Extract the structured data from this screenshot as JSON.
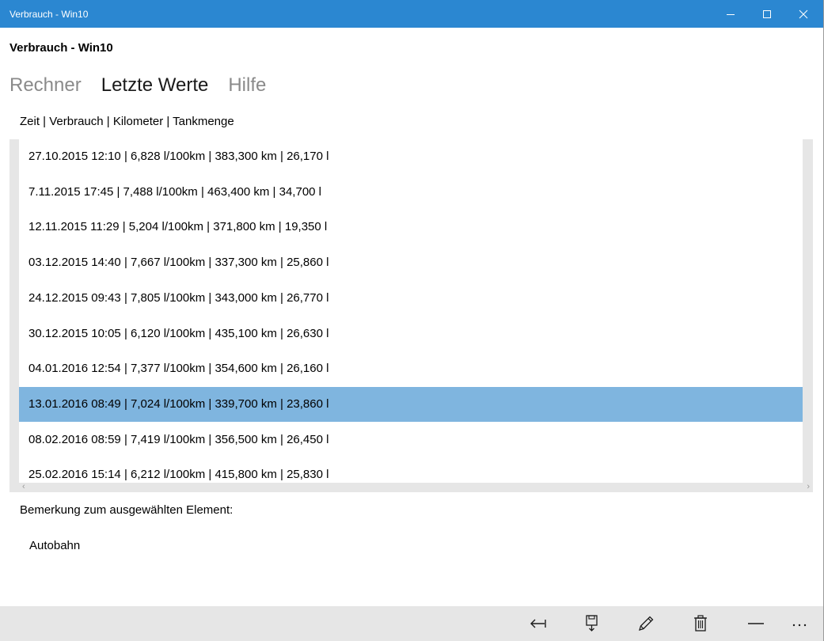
{
  "window": {
    "title": "Verbrauch - Win10",
    "controls": {
      "minimize": "minimize-icon",
      "maximize": "maximize-icon",
      "close": "close-icon"
    },
    "accent_color": "#2b87d1"
  },
  "app": {
    "title": "Verbrauch - Win10"
  },
  "pivot": {
    "tabs": [
      {
        "label": "Rechner",
        "active": false
      },
      {
        "label": "Letzte Werte",
        "active": true
      },
      {
        "label": "Hilfe",
        "active": false
      }
    ]
  },
  "list": {
    "header": "Zeit | Verbrauch | Kilometer | Tankmenge",
    "selected_index": 7,
    "selected_color": "#7fb5df",
    "rows": [
      "27.10.2015 12:10  |  6,828 l/100km  |  383,300 km  |  26,170 l",
      "7.11.2015 17:45  |  7,488 l/100km  |  463,400 km  |  34,700 l",
      "12.11.2015 11:29  |  5,204 l/100km  |  371,800 km  |  19,350 l",
      "03.12.2015 14:40  |  7,667 l/100km  |  337,300 km  |  25,860 l",
      "24.12.2015 09:43  |  7,805 l/100km  |  343,000 km  |  26,770 l",
      "30.12.2015 10:05  |  6,120 l/100km  |  435,100 km  |  26,630 l",
      "04.01.2016 12:54  |  7,377 l/100km  |  354,600 km  |  26,160 l",
      "13.01.2016 08:49  |  7,024 l/100km  |  339,700 km  |  23,860 l",
      "08.02.2016 08:59  |  7,419 l/100km  |  356,500 km  |  26,450 l",
      "25.02.2016 15:14  |  6,212 l/100km  |  415,800 km  |  25,830 l"
    ]
  },
  "remark": {
    "label": "Bemerkung zum ausgewählten Element:",
    "value": "Autobahn"
  },
  "appbar": {
    "buttons": [
      {
        "icon": "back-arrow-icon"
      },
      {
        "icon": "save-icon"
      },
      {
        "icon": "pencil-icon"
      },
      {
        "icon": "trash-icon"
      },
      {
        "icon": "minus-icon"
      },
      {
        "icon": "more-icon"
      }
    ]
  }
}
